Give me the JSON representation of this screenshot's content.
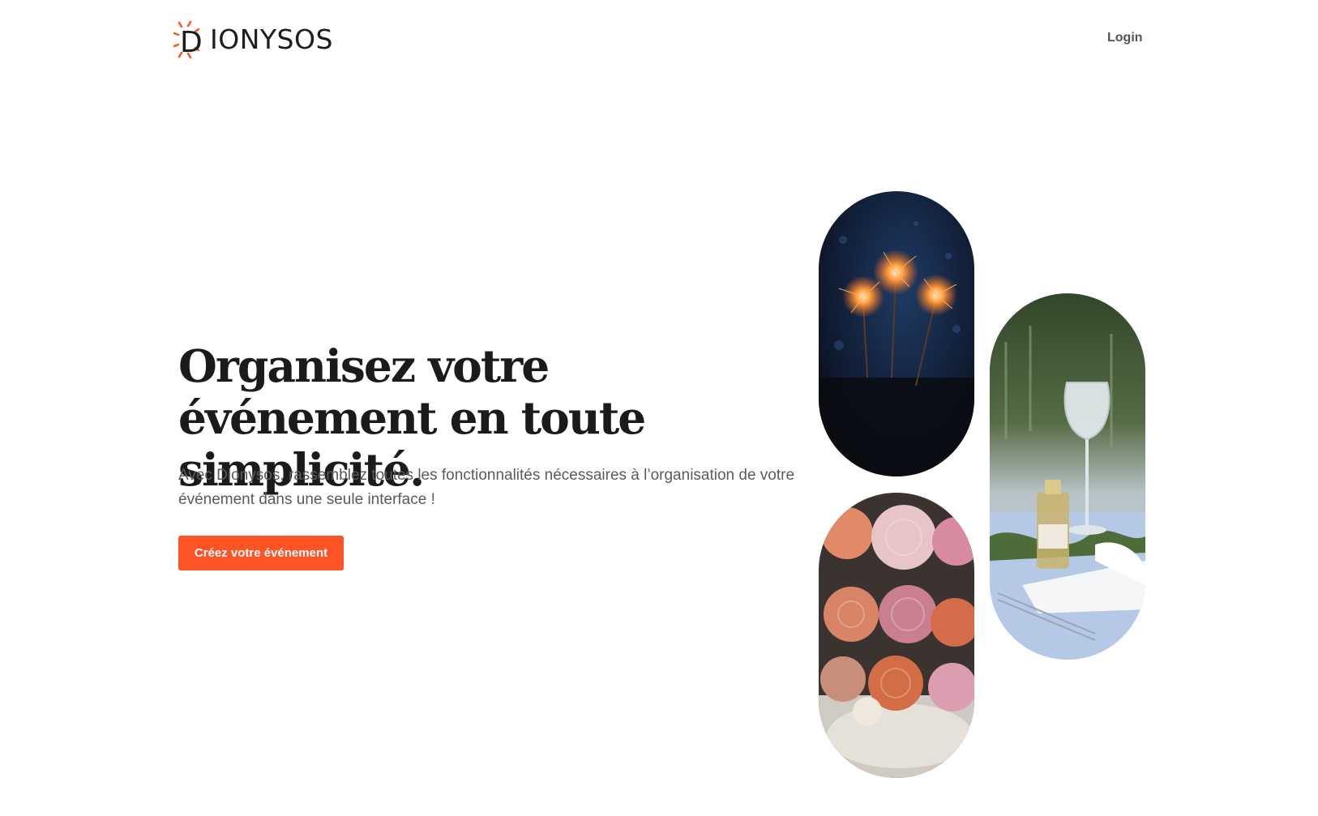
{
  "header": {
    "logo_text": "IONYSOS",
    "logo_letter": "D",
    "login_label": "Login"
  },
  "hero": {
    "title": "Organisez votre événement en toute simplicité.",
    "subtitle": "Avec Dionysos, rassemblez toutes les fonctionnalités nécessaires à l’organisation de votre événement dans une seule interface !",
    "cta_label": "Créez votre événement"
  },
  "theme": {
    "accent": "#ff5326",
    "text_dark": "#1b1b1b",
    "text_muted": "#5b5b5b"
  },
  "images": [
    {
      "name": "sparklers-image",
      "icon": "sparklers-photo"
    },
    {
      "name": "flowers-image",
      "icon": "flowers-photo"
    },
    {
      "name": "table-setting-image",
      "icon": "table-setting-photo"
    }
  ]
}
